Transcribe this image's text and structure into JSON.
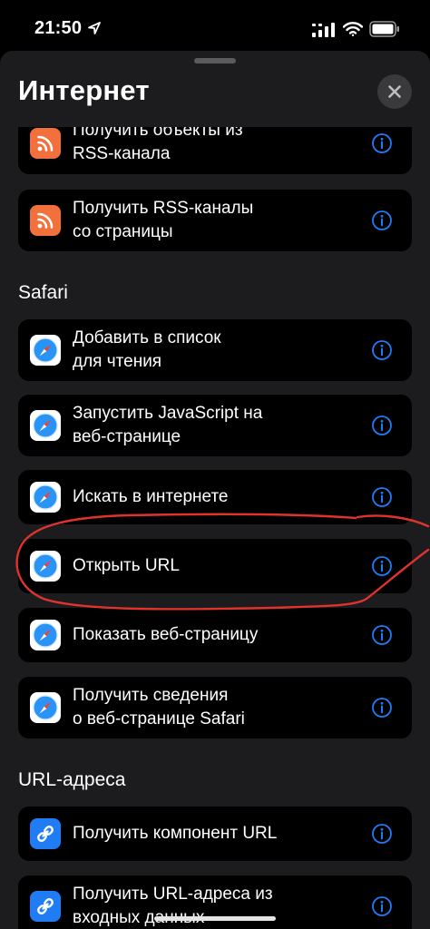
{
  "status_bar": {
    "time": "21:50"
  },
  "sheet": {
    "title": "Интернет"
  },
  "sections": {
    "safari_header": "Safari",
    "url_header": "URL-адреса"
  },
  "actions": {
    "rss_items": {
      "line1": "Получить объекты из",
      "line2": "RSS-канала"
    },
    "rss_feeds": {
      "line1": "Получить RSS-каналы",
      "line2": "со страницы"
    },
    "add_reading_list": {
      "line1": "Добавить в список",
      "line2": "для чтения"
    },
    "run_js": {
      "line1": "Запустить JavaScript на",
      "line2": "веб-странице"
    },
    "search_web": {
      "line1": "Искать в интернете"
    },
    "open_url": {
      "line1": "Открыть URL"
    },
    "show_webpage": {
      "line1": "Показать веб-страницу"
    },
    "safari_details": {
      "line1": "Получить сведения",
      "line2": "о веб-странице Safari"
    },
    "get_url_component": {
      "line1": "Получить компонент URL"
    },
    "get_urls_from_input": {
      "line1": "Получить URL-адреса из",
      "line2": "входных данных"
    }
  },
  "icons": {
    "rss": "rss-icon",
    "safari": "safari-compass-icon",
    "link": "link-icon",
    "info": "info-icon",
    "close": "close-icon"
  },
  "colors": {
    "accent": "#1f7cf5",
    "rss": "#f2703b",
    "annotation": "#e0332e",
    "card": "#000000",
    "sheet": "#1c1c1e"
  }
}
